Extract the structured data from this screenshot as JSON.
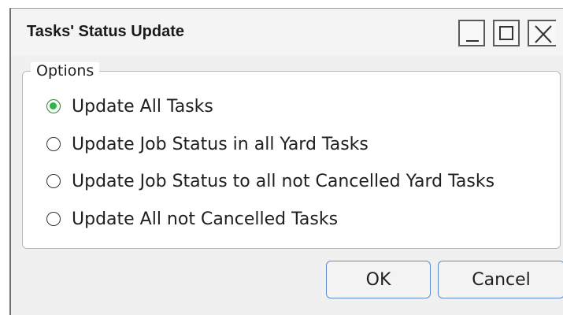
{
  "window": {
    "title": "Tasks' Status Update",
    "controls": {
      "minimize_icon": "minimize-icon",
      "maximize_icon": "maximize-icon",
      "close_icon": "close-icon"
    }
  },
  "options_group": {
    "legend": "Options",
    "selected_index": 0,
    "items": [
      {
        "label": "Update All Tasks",
        "checked": true
      },
      {
        "label": "Update Job Status in all Yard Tasks",
        "checked": false
      },
      {
        "label": "Update Job Status to all not Cancelled Yard Tasks",
        "checked": false
      },
      {
        "label": "Update All not Cancelled Tasks",
        "checked": false
      }
    ]
  },
  "buttons": {
    "ok": "OK",
    "cancel": "Cancel"
  },
  "colors": {
    "radio_selected": "#2db34a",
    "button_border": "#5b8ccf"
  }
}
